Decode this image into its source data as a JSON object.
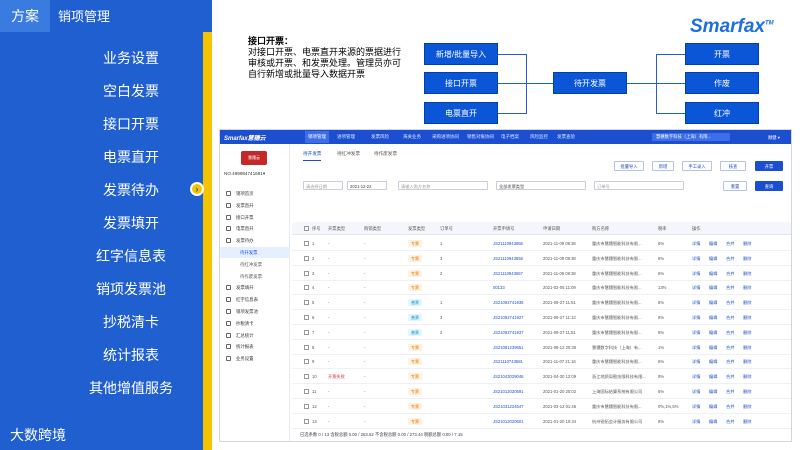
{
  "header": {
    "tab_a": "方案",
    "tab_b": "销项管理"
  },
  "menu": [
    "业务设置",
    "空白发票",
    "接口开票",
    "电票直开",
    "发票待办",
    "发票填开",
    "红字信息表",
    "销项发票池",
    "抄税清卡",
    "统计报表",
    "其他增值服务"
  ],
  "bottom_logo": "大数跨境",
  "brand": "Smarfax",
  "brand_tm": "TM",
  "description": {
    "title": "接口开票：",
    "body": "对接口开票、电票直开来源的票据进行审核或开票、和发票处理。管理员亦可自行新增或批量导入数据开票"
  },
  "flow": {
    "left": [
      "新增/批量导入",
      "接口开票",
      "电票直开"
    ],
    "center": "待开发票",
    "right": [
      "开票",
      "作废",
      "红冲"
    ]
  },
  "shot": {
    "brand": "Smarfax慧穗云",
    "topnav": [
      "销项管理",
      "进项管理",
      "发票风险",
      "海关业务",
      "采购进项协同",
      "销售对账协同",
      "电子档案",
      "风险监控",
      "发票查验"
    ],
    "company": "慧穗数字科技（上海）有限...",
    "user": "顾健 ▾",
    "avatar": "慧穗云",
    "no": "NO.499984741681▾",
    "sidebar": [
      {
        "label": "销项首页",
        "sub": false,
        "sel": false
      },
      {
        "label": "发票直开",
        "sub": false,
        "sel": false
      },
      {
        "label": "接口开票",
        "sub": false,
        "sel": false
      },
      {
        "label": "电票直开",
        "sub": false,
        "sel": false
      },
      {
        "label": "发票待办",
        "sub": false,
        "sel": false
      },
      {
        "label": "待开发票",
        "sub": true,
        "sel": true
      },
      {
        "label": "待红冲发票",
        "sub": true,
        "sel": false
      },
      {
        "label": "待作废发票",
        "sub": true,
        "sel": false
      },
      {
        "label": "发票填开",
        "sub": false,
        "sel": false
      },
      {
        "label": "红字信息表",
        "sub": false,
        "sel": false
      },
      {
        "label": "销项发票池",
        "sub": false,
        "sel": false
      },
      {
        "label": "抄税清卡",
        "sub": false,
        "sel": false
      },
      {
        "label": "汇总统计",
        "sub": false,
        "sel": false
      },
      {
        "label": "统计报表",
        "sub": false,
        "sel": false
      },
      {
        "label": "业务设置",
        "sub": false,
        "sel": false
      }
    ],
    "tabs": [
      "待开发票",
      "待红冲发票",
      "待作废发票"
    ],
    "buttons": [
      "批量导入",
      "新增",
      "手工录入",
      "核查",
      "开票"
    ],
    "filters": {
      "date_from": "请选择日期",
      "date_to": "2021-12-22",
      "buyer": "请输入购方名称",
      "type": "全部发票类型",
      "order": "订单号"
    },
    "filter_buttons": [
      "重置",
      "查询"
    ],
    "columns": [
      "序号",
      "开票类型",
      "购销类型",
      "发票类型",
      "订单号",
      "开票申请号",
      "申请日期",
      "购方名称",
      "税率",
      "操作"
    ],
    "rows": [
      {
        "n": "1",
        "kp": "-",
        "gx": "-",
        "ty": "专票",
        "tc": "zhuan",
        "od": "1",
        "no": "JS21110943656",
        "dt": "2021-11-09 09:38",
        "buyer": "重庆市慧穗智能科技有限...",
        "rate": "6%"
      },
      {
        "n": "2",
        "kp": "-",
        "gx": "-",
        "ty": "专票",
        "tc": "zhuan",
        "od": "3",
        "no": "JS21110943658",
        "dt": "2021-11-09 09:38",
        "buyer": "重庆市慧穗智能科技有限...",
        "rate": "6%"
      },
      {
        "n": "3",
        "kp": "-",
        "gx": "-",
        "ty": "专票",
        "tc": "zhuan",
        "od": "2",
        "no": "JS21110943657",
        "dt": "2021-11-09 09:38",
        "buyer": "重庆市慧穗智能科技有限...",
        "rate": "6%"
      },
      {
        "n": "4",
        "kp": "-",
        "gx": "-",
        "ty": "专票",
        "tc": "zhuan",
        "od": "",
        "no": "00133",
        "dt": "2021-02-05 11:09",
        "buyer": "重庆市慧穗智能科技有限...",
        "rate": "13%"
      },
      {
        "n": "5",
        "kp": "-",
        "gx": "-",
        "ty": "普票",
        "tc": "pu",
        "od": "1",
        "no": "JS21092741936",
        "dt": "2021-09-27 11:51",
        "buyer": "重庆市慧穗智能科技有限...",
        "rate": "6%"
      },
      {
        "n": "6",
        "kp": "-",
        "gx": "-",
        "ty": "普票",
        "tc": "pu",
        "od": "3",
        "no": "JS21092741927",
        "dt": "2021-09-27 11:13",
        "buyer": "重庆市慧穗智能科技有限...",
        "rate": "6%"
      },
      {
        "n": "7",
        "kp": "-",
        "gx": "-",
        "ty": "普票",
        "tc": "pu",
        "od": "2",
        "no": "JS21092741937",
        "dt": "2021-09-27 11:51",
        "buyer": "重庆市慧穗智能科技有限...",
        "rate": "6%"
      },
      {
        "n": "8",
        "kp": "-",
        "gx": "-",
        "ty": "专票",
        "tc": "zhuan",
        "od": "",
        "no": "JS21081239651",
        "dt": "2021-08-12 20:36",
        "buyer": "慧穗数字科技（上海）有...",
        "rate": "1%"
      },
      {
        "n": "9",
        "kp": "-",
        "gx": "-",
        "ty": "专票",
        "tc": "zhuan",
        "od": "",
        "no": "JS21110743581",
        "dt": "2021-11-07 21:16",
        "buyer": "重庆市慧穗智能科技有限...",
        "rate": "6%"
      },
      {
        "n": "10",
        "kp": "开票失败",
        "gx": "-",
        "ty": "专票",
        "tc": "zhuan",
        "od": "",
        "no": "JS21043029046",
        "dt": "2021-04-30 12:09",
        "buyer": "浙江地质局勘技限科技有限...",
        "rate": "9%"
      },
      {
        "n": "11",
        "kp": "-",
        "gx": "-",
        "ty": "专票",
        "tc": "zhuan",
        "od": "",
        "no": "JS21012020591",
        "dt": "2021-01-20 20:02",
        "buyer": "上海国际结算系统有限公司",
        "rate": "6%"
      },
      {
        "n": "12",
        "kp": "-",
        "gx": "-",
        "ty": "专票",
        "tc": "zhuan",
        "od": "",
        "no": "JS21031224547",
        "dt": "2021-03-12 01:46",
        "buyer": "重庆市慧穗智能科技有限...",
        "rate": "0%,1%,5%"
      },
      {
        "n": "13",
        "kp": "-",
        "gx": "-",
        "ty": "专票",
        "tc": "zhuan",
        "od": "",
        "no": "JS21012020601",
        "dt": "2021-01-20 10:34",
        "buyer": "杭州锐拓会计服务有限公司",
        "rate": "6%"
      }
    ],
    "ops": [
      "详情",
      "编辑",
      "合并",
      "删除"
    ],
    "footer": "已选条数 0 / 13    含税总额 0.00 / 263.62    不含税总额 0.00 / 273.44    税额总额 0.00 / 7.15"
  }
}
